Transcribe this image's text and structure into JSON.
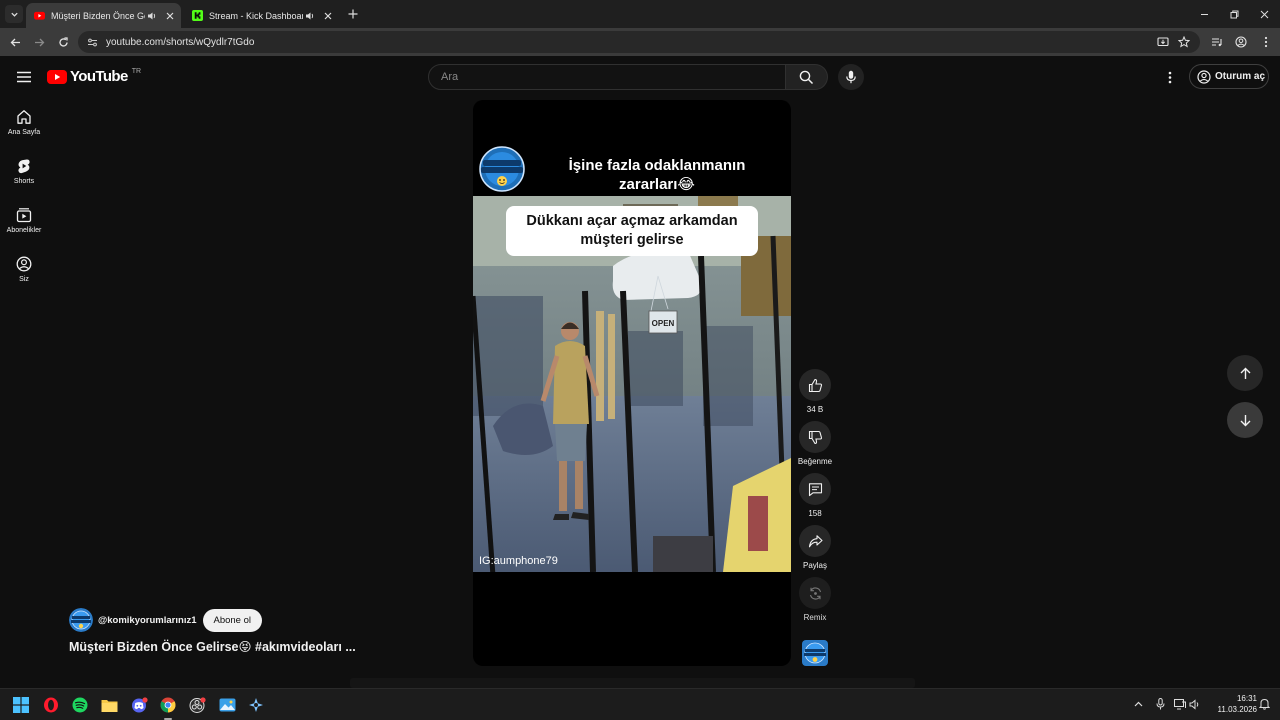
{
  "browser": {
    "tabs": [
      {
        "title": "Müşteri Bizden Önce Gelirse",
        "active": true,
        "favicon": "youtube-favicon"
      },
      {
        "title": "Stream - Kick Dashboard",
        "active": false,
        "favicon": "kick-favicon"
      }
    ],
    "url": "youtube.com/shorts/wQydlr7tGdo"
  },
  "youtube": {
    "logo_text": "YouTube",
    "country_code": "TR",
    "search_placeholder": "Ara",
    "signin_label": "Oturum aç"
  },
  "sidebar": {
    "items": [
      {
        "label": "Ana Sayfa",
        "icon": "home-icon"
      },
      {
        "label": "Shorts",
        "icon": "shorts-icon"
      },
      {
        "label": "Abonelikler",
        "icon": "subscriptions-icon"
      },
      {
        "label": "Siz",
        "icon": "you-icon"
      }
    ]
  },
  "video": {
    "header_line1": "İşine fazla odaklanmanın",
    "header_line2": "zararları😂",
    "caption_line1": "Dükkanı açar açmaz arkamdan",
    "caption_line2": "müşteri gelirse",
    "watermark": "IG:aumphone79",
    "sign_text": "OPEN",
    "logo_text": "KOMİK YORUMLARINIZ"
  },
  "actions": {
    "like_count": "34 B",
    "dislike_label": "Beğenme",
    "comment_count": "158",
    "share_label": "Paylaş",
    "remix_label": "Remix"
  },
  "channel": {
    "handle": "@komikyorumlarınız1",
    "subscribe_label": "Abone ol",
    "video_title": "Müşteri Bizden Önce Gelirse😝 #akımvideoları  ..."
  },
  "taskbar": {
    "time": "16:31",
    "date": "11.03.2026",
    "apps": [
      "windows-start",
      "opera",
      "spotify",
      "file-explorer",
      "discord",
      "chrome",
      "obs",
      "photos",
      "steam"
    ]
  },
  "colors": {
    "background": "#0f0f0f",
    "youtube_red": "#ff0000",
    "kick_green": "#53fc18"
  }
}
